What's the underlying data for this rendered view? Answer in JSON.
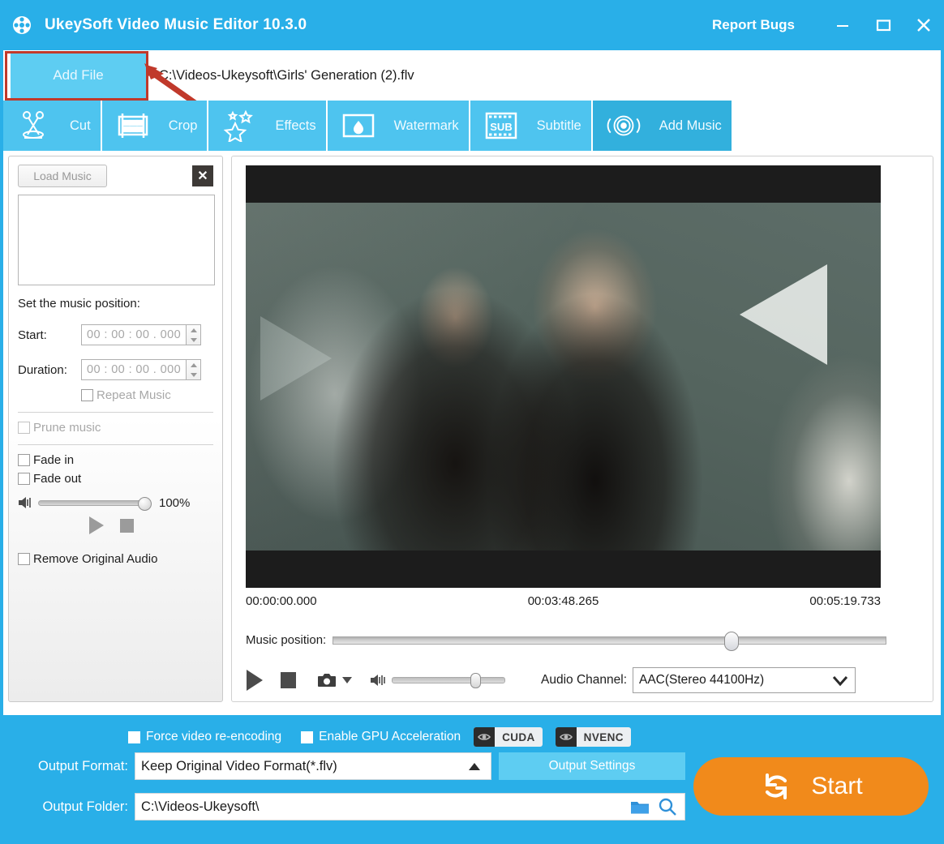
{
  "window": {
    "title": "UkeySoft Video Music Editor 10.3.0",
    "app_icon": "film-reel-icon",
    "report_bugs": "Report Bugs",
    "minimize": "minimize-icon",
    "maximize": "maximize-icon",
    "close": "close-icon",
    "accent_blue": "#29afe8"
  },
  "filebar": {
    "add_file_label": "Add File",
    "file_path": "C:\\Videos-Ukeysoft\\Girls' Generation (2).flv",
    "annotation_color": "#c0392b"
  },
  "tabs": [
    {
      "label": "Cut",
      "icon": "scissors-icon",
      "active": false
    },
    {
      "label": "Crop",
      "icon": "crop-frame-icon",
      "active": false
    },
    {
      "label": "Effects",
      "icon": "stars-icon",
      "active": false
    },
    {
      "label": "Watermark",
      "icon": "watermark-drop-icon",
      "active": false
    },
    {
      "label": "Subtitle",
      "icon": "subtitle-film-icon",
      "active": false
    },
    {
      "label": "Add Music",
      "icon": "target-rings-icon",
      "active": true
    }
  ],
  "music_panel": {
    "load_music_label": "Load Music",
    "close_label": "✕",
    "position_heading": "Set the music position:",
    "start_label": "Start:",
    "start_value": "00 : 00 : 00 . 000",
    "duration_label": "Duration:",
    "duration_value": "00 : 00 : 00 . 000",
    "repeat_music_label": "Repeat Music",
    "prune_music_label": "Prune music",
    "fade_in_label": "Fade in",
    "fade_out_label": "Fade out",
    "volume_percent": "100%",
    "volume_value": 100,
    "play_label": "play-icon",
    "stop_label": "stop-icon",
    "remove_original_audio_label": "Remove Original Audio"
  },
  "preview": {
    "time_start": "00:00:00.000",
    "time_current": "00:03:48.265",
    "time_end": "00:05:19.733",
    "music_position_label": "Music position:",
    "music_position_value": 71,
    "player_volume_value": 68,
    "audio_channel_label": "Audio Channel:",
    "audio_channel_value": "AAC(Stereo 44100Hz)"
  },
  "bottom": {
    "force_reencode_label": "Force video re-encoding",
    "enable_gpu_label": "Enable GPU Acceleration",
    "cuda_label": "CUDA",
    "nvenc_label": "NVENC",
    "output_format_label": "Output Format:",
    "output_format_value": "Keep Original Video Format(*.flv)",
    "output_settings_label": "Output Settings",
    "output_folder_label": "Output Folder:",
    "output_folder_value": "C:\\Videos-Ukeysoft\\",
    "folder_icon": "folder-icon",
    "search_icon": "magnifier-icon",
    "start_label": "Start",
    "start_icon": "refresh-cycle-icon",
    "start_color": "#f18a1b"
  }
}
